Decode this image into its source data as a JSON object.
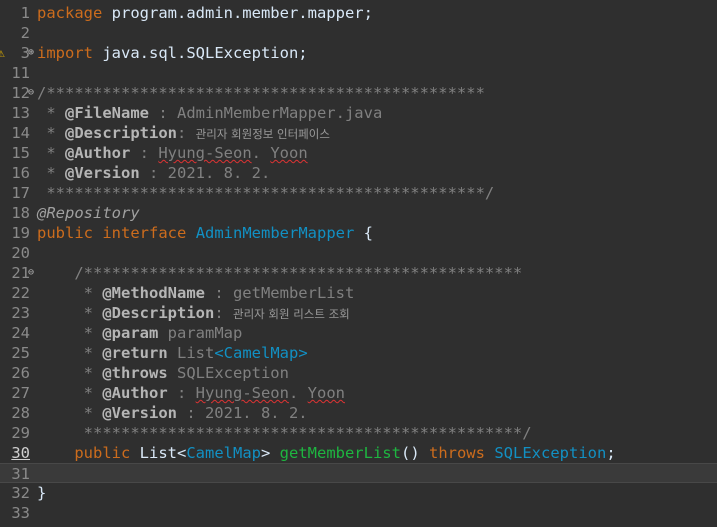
{
  "editor": {
    "current_line": 30,
    "lines": [
      {
        "num": "1",
        "segments": [
          {
            "t": "package",
            "c": "kw"
          },
          {
            "t": " program.admin.member.mapper;",
            "c": "norm"
          }
        ]
      },
      {
        "num": "2",
        "segments": []
      },
      {
        "num": "3",
        "fold": "collapsed",
        "marker": "warning",
        "segments": [
          {
            "t": "import",
            "c": "kw"
          },
          {
            "t": " java.sql.SQLException;",
            "c": "norm"
          }
        ]
      },
      {
        "num": "11",
        "segments": []
      },
      {
        "num": "12",
        "fold": "open",
        "segments": [
          {
            "t": "/***********************************************",
            "c": "cm"
          }
        ]
      },
      {
        "num": "13",
        "segments": [
          {
            "t": " * ",
            "c": "cm"
          },
          {
            "t": "@FileName",
            "c": "tag"
          },
          {
            "t": " : AdminMemberMapper.java",
            "c": "cm"
          }
        ]
      },
      {
        "num": "14",
        "segments": [
          {
            "t": " * ",
            "c": "cm"
          },
          {
            "t": "@Description",
            "c": "tag"
          },
          {
            "t": ": ",
            "c": "cm"
          },
          {
            "t": "관리자 회원정보 인터페이스",
            "c": "kr"
          }
        ]
      },
      {
        "num": "15",
        "segments": [
          {
            "t": " * ",
            "c": "cm"
          },
          {
            "t": "@Author",
            "c": "tag"
          },
          {
            "t": " : ",
            "c": "cm"
          },
          {
            "t": "Hyung-Seon",
            "c": "cm",
            "squig": true
          },
          {
            "t": ". ",
            "c": "cm"
          },
          {
            "t": "Yoon",
            "c": "cm",
            "squig": true
          }
        ]
      },
      {
        "num": "16",
        "segments": [
          {
            "t": " * ",
            "c": "cm"
          },
          {
            "t": "@Version",
            "c": "tag"
          },
          {
            "t": " : 2021. 8. 2.",
            "c": "cm"
          }
        ]
      },
      {
        "num": "17",
        "segments": [
          {
            "t": " ***********************************************/",
            "c": "cm"
          }
        ]
      },
      {
        "num": "18",
        "segments": [
          {
            "t": "@Repository",
            "c": "ann"
          }
        ]
      },
      {
        "num": "19",
        "segments": [
          {
            "t": "public",
            "c": "kw"
          },
          {
            "t": " ",
            "c": "norm"
          },
          {
            "t": "interface",
            "c": "kw"
          },
          {
            "t": " ",
            "c": "norm"
          },
          {
            "t": "AdminMemberMapper",
            "c": "type"
          },
          {
            "t": " {",
            "c": "norm"
          }
        ]
      },
      {
        "num": "20",
        "segments": []
      },
      {
        "num": "21",
        "fold": "open",
        "segments": [
          {
            "t": "    /***********************************************",
            "c": "cm"
          }
        ]
      },
      {
        "num": "22",
        "segments": [
          {
            "t": "     * ",
            "c": "cm"
          },
          {
            "t": "@MethodName",
            "c": "tag"
          },
          {
            "t": " : getMemberList",
            "c": "cm"
          }
        ]
      },
      {
        "num": "23",
        "segments": [
          {
            "t": "     * ",
            "c": "cm"
          },
          {
            "t": "@Description",
            "c": "tag"
          },
          {
            "t": ": ",
            "c": "cm"
          },
          {
            "t": "관리자 회원 리스트 조회",
            "c": "kr"
          }
        ]
      },
      {
        "num": "24",
        "segments": [
          {
            "t": "     * ",
            "c": "cm"
          },
          {
            "t": "@param",
            "c": "tag"
          },
          {
            "t": " paramMap",
            "c": "cm"
          }
        ]
      },
      {
        "num": "25",
        "segments": [
          {
            "t": "     * ",
            "c": "cm"
          },
          {
            "t": "@return",
            "c": "tag"
          },
          {
            "t": " List",
            "c": "cm"
          },
          {
            "t": "<CamelMap>",
            "c": "type"
          }
        ]
      },
      {
        "num": "26",
        "segments": [
          {
            "t": "     * ",
            "c": "cm"
          },
          {
            "t": "@throws",
            "c": "tag"
          },
          {
            "t": " SQLException",
            "c": "cm"
          }
        ]
      },
      {
        "num": "27",
        "segments": [
          {
            "t": "     * ",
            "c": "cm"
          },
          {
            "t": "@Author",
            "c": "tag"
          },
          {
            "t": " : ",
            "c": "cm"
          },
          {
            "t": "Hyung-Seon",
            "c": "cm",
            "squig": true
          },
          {
            "t": ". ",
            "c": "cm"
          },
          {
            "t": "Yoon",
            "c": "cm",
            "squig": true
          }
        ]
      },
      {
        "num": "28",
        "segments": [
          {
            "t": "     * ",
            "c": "cm"
          },
          {
            "t": "@Version",
            "c": "tag"
          },
          {
            "t": " : 2021. 8. 2.",
            "c": "cm"
          }
        ]
      },
      {
        "num": "29",
        "segments": [
          {
            "t": "     ***********************************************/",
            "c": "cm"
          }
        ]
      },
      {
        "num": "30",
        "segments": [
          {
            "t": "    ",
            "c": "norm"
          },
          {
            "t": "public",
            "c": "kw"
          },
          {
            "t": " List<",
            "c": "norm"
          },
          {
            "t": "CamelMap",
            "c": "type"
          },
          {
            "t": "> ",
            "c": "norm"
          },
          {
            "t": "getMemberList",
            "c": "meth"
          },
          {
            "t": "() ",
            "c": "norm"
          },
          {
            "t": "throws",
            "c": "kw"
          },
          {
            "t": " ",
            "c": "norm"
          },
          {
            "t": "SQLException",
            "c": "type"
          },
          {
            "t": ";",
            "c": "norm"
          }
        ]
      },
      {
        "num": "31",
        "current": true,
        "segments": []
      },
      {
        "num": "32",
        "segments": [
          {
            "t": "}",
            "c": "norm"
          }
        ]
      },
      {
        "num": "33",
        "segments": []
      }
    ]
  },
  "colors": {
    "background": "#2f2f2f",
    "keyword": "#cc6c1d",
    "type": "#1290c3",
    "method": "#1eb540",
    "comment": "#808080"
  }
}
